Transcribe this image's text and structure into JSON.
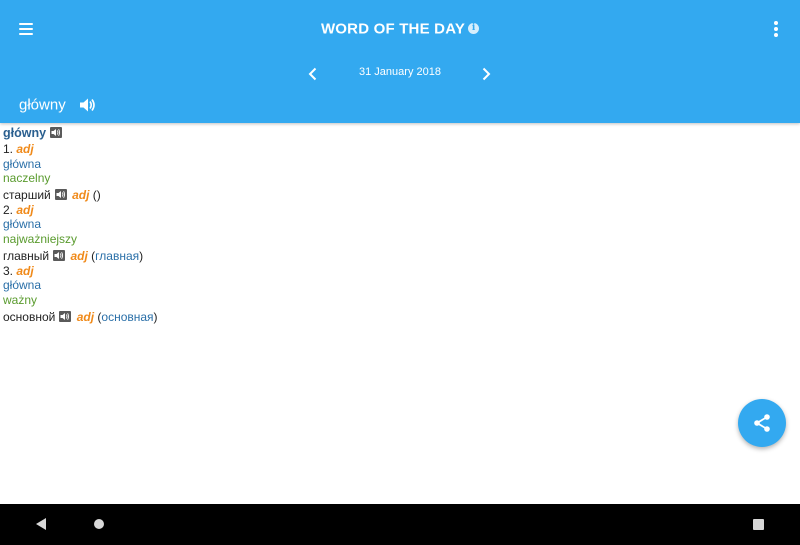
{
  "header": {
    "title": "WORD OF THE DAY",
    "info_glyph": "i",
    "date": "31 January 2018",
    "word": "główny",
    "color": "#33a9f0"
  },
  "entry": {
    "headword": "główny",
    "senses": [
      {
        "number": "1.",
        "pos": "adj",
        "forms": [
          "główna",
          "naczelny"
        ],
        "translation": {
          "word": "старший",
          "pos": "adj",
          "open": "(",
          "note": "",
          "close": ")"
        }
      },
      {
        "number": "2.",
        "pos": "adj",
        "forms": [
          "główna",
          "najważniejszy"
        ],
        "translation": {
          "word": "главный",
          "pos": "adj",
          "open": "(",
          "note": "главная",
          "close": ")"
        }
      },
      {
        "number": "3.",
        "pos": "adj",
        "forms": [
          "główna",
          "ważny"
        ],
        "translation": {
          "word": "основной",
          "pos": "adj",
          "open": "(",
          "note": "основная",
          "close": ")"
        }
      }
    ]
  },
  "icons": {
    "menu": "hamburger-icon",
    "more": "more-vertical-icon",
    "prev": "chevron-left-icon",
    "next": "chevron-right-icon",
    "speaker": "speaker-icon",
    "share": "share-icon"
  }
}
